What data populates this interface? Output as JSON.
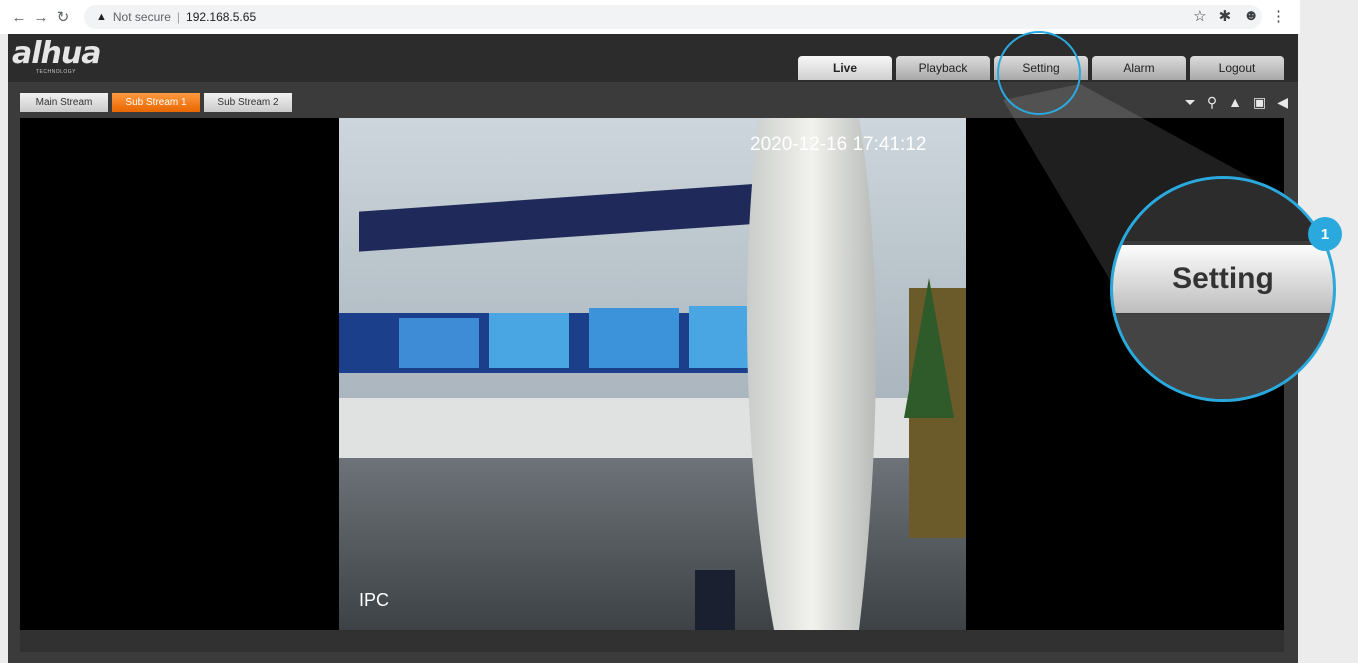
{
  "browser": {
    "security_label": "Not secure",
    "url": "192.168.5.65"
  },
  "app": {
    "logo": "alhua",
    "logo_sub": "TECHNOLOGY"
  },
  "nav_tabs": [
    {
      "label": "Live",
      "active": true
    },
    {
      "label": "Playback",
      "active": false
    },
    {
      "label": "Setting",
      "active": false
    },
    {
      "label": "Alarm",
      "active": false
    },
    {
      "label": "Logout",
      "active": false
    }
  ],
  "streams": [
    {
      "label": "Main Stream",
      "active": false
    },
    {
      "label": "Sub Stream 1",
      "active": true
    },
    {
      "label": "Sub Stream 2",
      "active": false
    }
  ],
  "toolbar_icons": [
    "ptz-icon",
    "light-icon",
    "alarm-bell-icon",
    "snapshot-icon",
    "audio-icon"
  ],
  "video": {
    "timestamp": "2020-12-16 17:41:12",
    "channel_name": "IPC"
  },
  "callout": {
    "zoom_label": "Setting",
    "step_number": "1",
    "accent_color": "#2aa9de"
  }
}
